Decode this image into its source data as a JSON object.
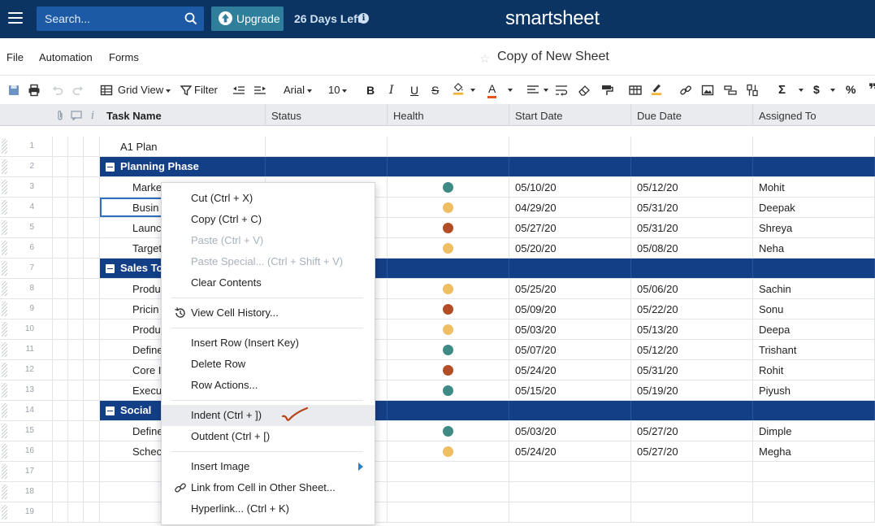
{
  "topbar": {
    "search_placeholder": "Search...",
    "upgrade_label": "Upgrade",
    "trial_days_left": "26 Days Left",
    "brand": "smartsheet"
  },
  "menu": {
    "file": "File",
    "automation": "Automation",
    "forms": "Forms",
    "sheet_title": "Copy of New Sheet"
  },
  "toolbar": {
    "view": "Grid View",
    "filter": "Filter",
    "font": "Arial",
    "font_size": "10",
    "bold": "B",
    "italic": "I",
    "underline": "U",
    "strike": "S",
    "text_color_letter": "A",
    "sum": "Σ",
    "currency": "$",
    "percent": "%",
    "text_color": "#e2561e",
    "highlight_color": "#f2b233"
  },
  "columns": {
    "info_marker": "i",
    "task": "Task Name",
    "status": "Status",
    "health": "Health",
    "start": "Start Date",
    "due": "Due Date",
    "assigned": "Assigned To"
  },
  "health_colors": {
    "green": "#3e8a85",
    "yellow": "#efbd62",
    "red": "#b24d25"
  },
  "rows": [
    {
      "num": "1",
      "task": "A1 Plan",
      "health": "",
      "start": "",
      "due": "",
      "assigned": ""
    },
    {
      "num": "2",
      "task": "Planning Phase",
      "parent": true
    },
    {
      "num": "3",
      "task": "Marke",
      "health": "green",
      "start": "05/10/20",
      "due": "05/12/20",
      "assigned": "Mohit"
    },
    {
      "num": "4",
      "task": "Busin",
      "health": "yellow",
      "start": "04/29/20",
      "due": "05/31/20",
      "assigned": "Deepak"
    },
    {
      "num": "5",
      "task": "Launc",
      "health": "red",
      "start": "05/27/20",
      "due": "05/31/20",
      "assigned": "Shreya"
    },
    {
      "num": "6",
      "task": "Target",
      "health": "yellow",
      "start": "05/20/20",
      "due": "05/08/20",
      "assigned": "Neha"
    },
    {
      "num": "7",
      "task": "Sales To",
      "parent": true
    },
    {
      "num": "8",
      "task": "Produ",
      "health": "yellow",
      "start": "05/25/20",
      "due": "05/06/20",
      "assigned": "Sachin"
    },
    {
      "num": "9",
      "task": "Pricin",
      "health": "red",
      "start": "05/09/20",
      "due": "05/22/20",
      "assigned": "Sonu"
    },
    {
      "num": "10",
      "task": "Produ",
      "health": "yellow",
      "start": "05/03/20",
      "due": "05/13/20",
      "assigned": "Deepa"
    },
    {
      "num": "11",
      "task": "Define",
      "health": "green",
      "start": "05/07/20",
      "due": "05/12/20",
      "assigned": "Trishant"
    },
    {
      "num": "12",
      "task": "Core I",
      "health": "red",
      "start": "05/24/20",
      "due": "05/31/20",
      "assigned": "Rohit"
    },
    {
      "num": "13",
      "task": "Execu",
      "health": "green",
      "start": "05/15/20",
      "due": "05/19/20",
      "assigned": "Piyush"
    },
    {
      "num": "14",
      "task": "Social",
      "parent": true
    },
    {
      "num": "15",
      "task": "Define",
      "health": "green",
      "start": "05/03/20",
      "due": "05/27/20",
      "assigned": "Dimple"
    },
    {
      "num": "16",
      "task": "Schec",
      "health": "yellow",
      "start": "05/24/20",
      "due": "05/27/20",
      "assigned": "Megha"
    },
    {
      "num": "17",
      "task": "",
      "health": "",
      "start": "",
      "due": "",
      "assigned": ""
    },
    {
      "num": "18",
      "task": "",
      "health": "",
      "start": "",
      "due": "",
      "assigned": ""
    },
    {
      "num": "19",
      "task": "",
      "health": "",
      "start": "",
      "due": "",
      "assigned": ""
    }
  ],
  "context_menu": {
    "cut": "Cut (Ctrl + X)",
    "copy": "Copy (Ctrl + C)",
    "paste": "Paste (Ctrl + V)",
    "paste_special": "Paste Special... (Ctrl + Shift + V)",
    "clear": "Clear Contents",
    "history": "View Cell History...",
    "insert_row": "Insert Row (Insert Key)",
    "delete_row": "Delete Row",
    "row_actions": "Row Actions...",
    "indent": "Indent (Ctrl + ])",
    "outdent": "Outdent (Ctrl + [)",
    "insert_image": "Insert Image",
    "link_other_sheet": "Link from Cell in Other Sheet...",
    "hyperlink": "Hyperlink... (Ctrl + K)"
  }
}
